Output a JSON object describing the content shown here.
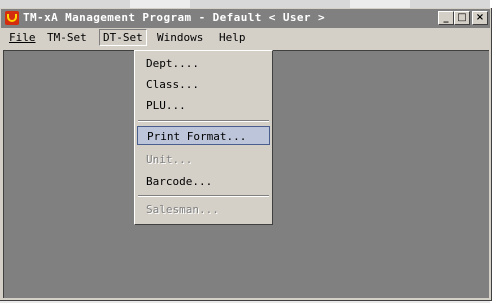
{
  "window": {
    "title": "TM-xA Management Program - Default < User >",
    "buttons": {
      "minimize": "_",
      "maximize": "□",
      "close": "×"
    }
  },
  "menubar": {
    "items": [
      {
        "label": "File",
        "mnemonic": "F"
      },
      {
        "label": "TM-Set",
        "mnemonic": "T"
      },
      {
        "label": "DT-Set",
        "mnemonic": "D",
        "active": true
      },
      {
        "label": "Windows",
        "mnemonic": "W"
      },
      {
        "label": "Help",
        "mnemonic": "H"
      }
    ]
  },
  "dropdown": {
    "items": [
      {
        "label": "Dept....",
        "enabled": true
      },
      {
        "label": "Class...",
        "enabled": true
      },
      {
        "label": "PLU...",
        "enabled": true
      },
      {
        "label": "Print Format...",
        "enabled": true,
        "highlighted": true
      },
      {
        "label": "Unit...",
        "enabled": false
      },
      {
        "label": "Barcode...",
        "enabled": true
      },
      {
        "label": "Salesman...",
        "enabled": false
      }
    ]
  },
  "colors": {
    "titlebar_inactive": "#808080",
    "face": "#d4d0c8",
    "mdi_background": "#808080",
    "highlight_fill": "#bdc5da",
    "highlight_border": "#4b5f8f"
  },
  "icons": {
    "app": "app-logo-icon"
  }
}
